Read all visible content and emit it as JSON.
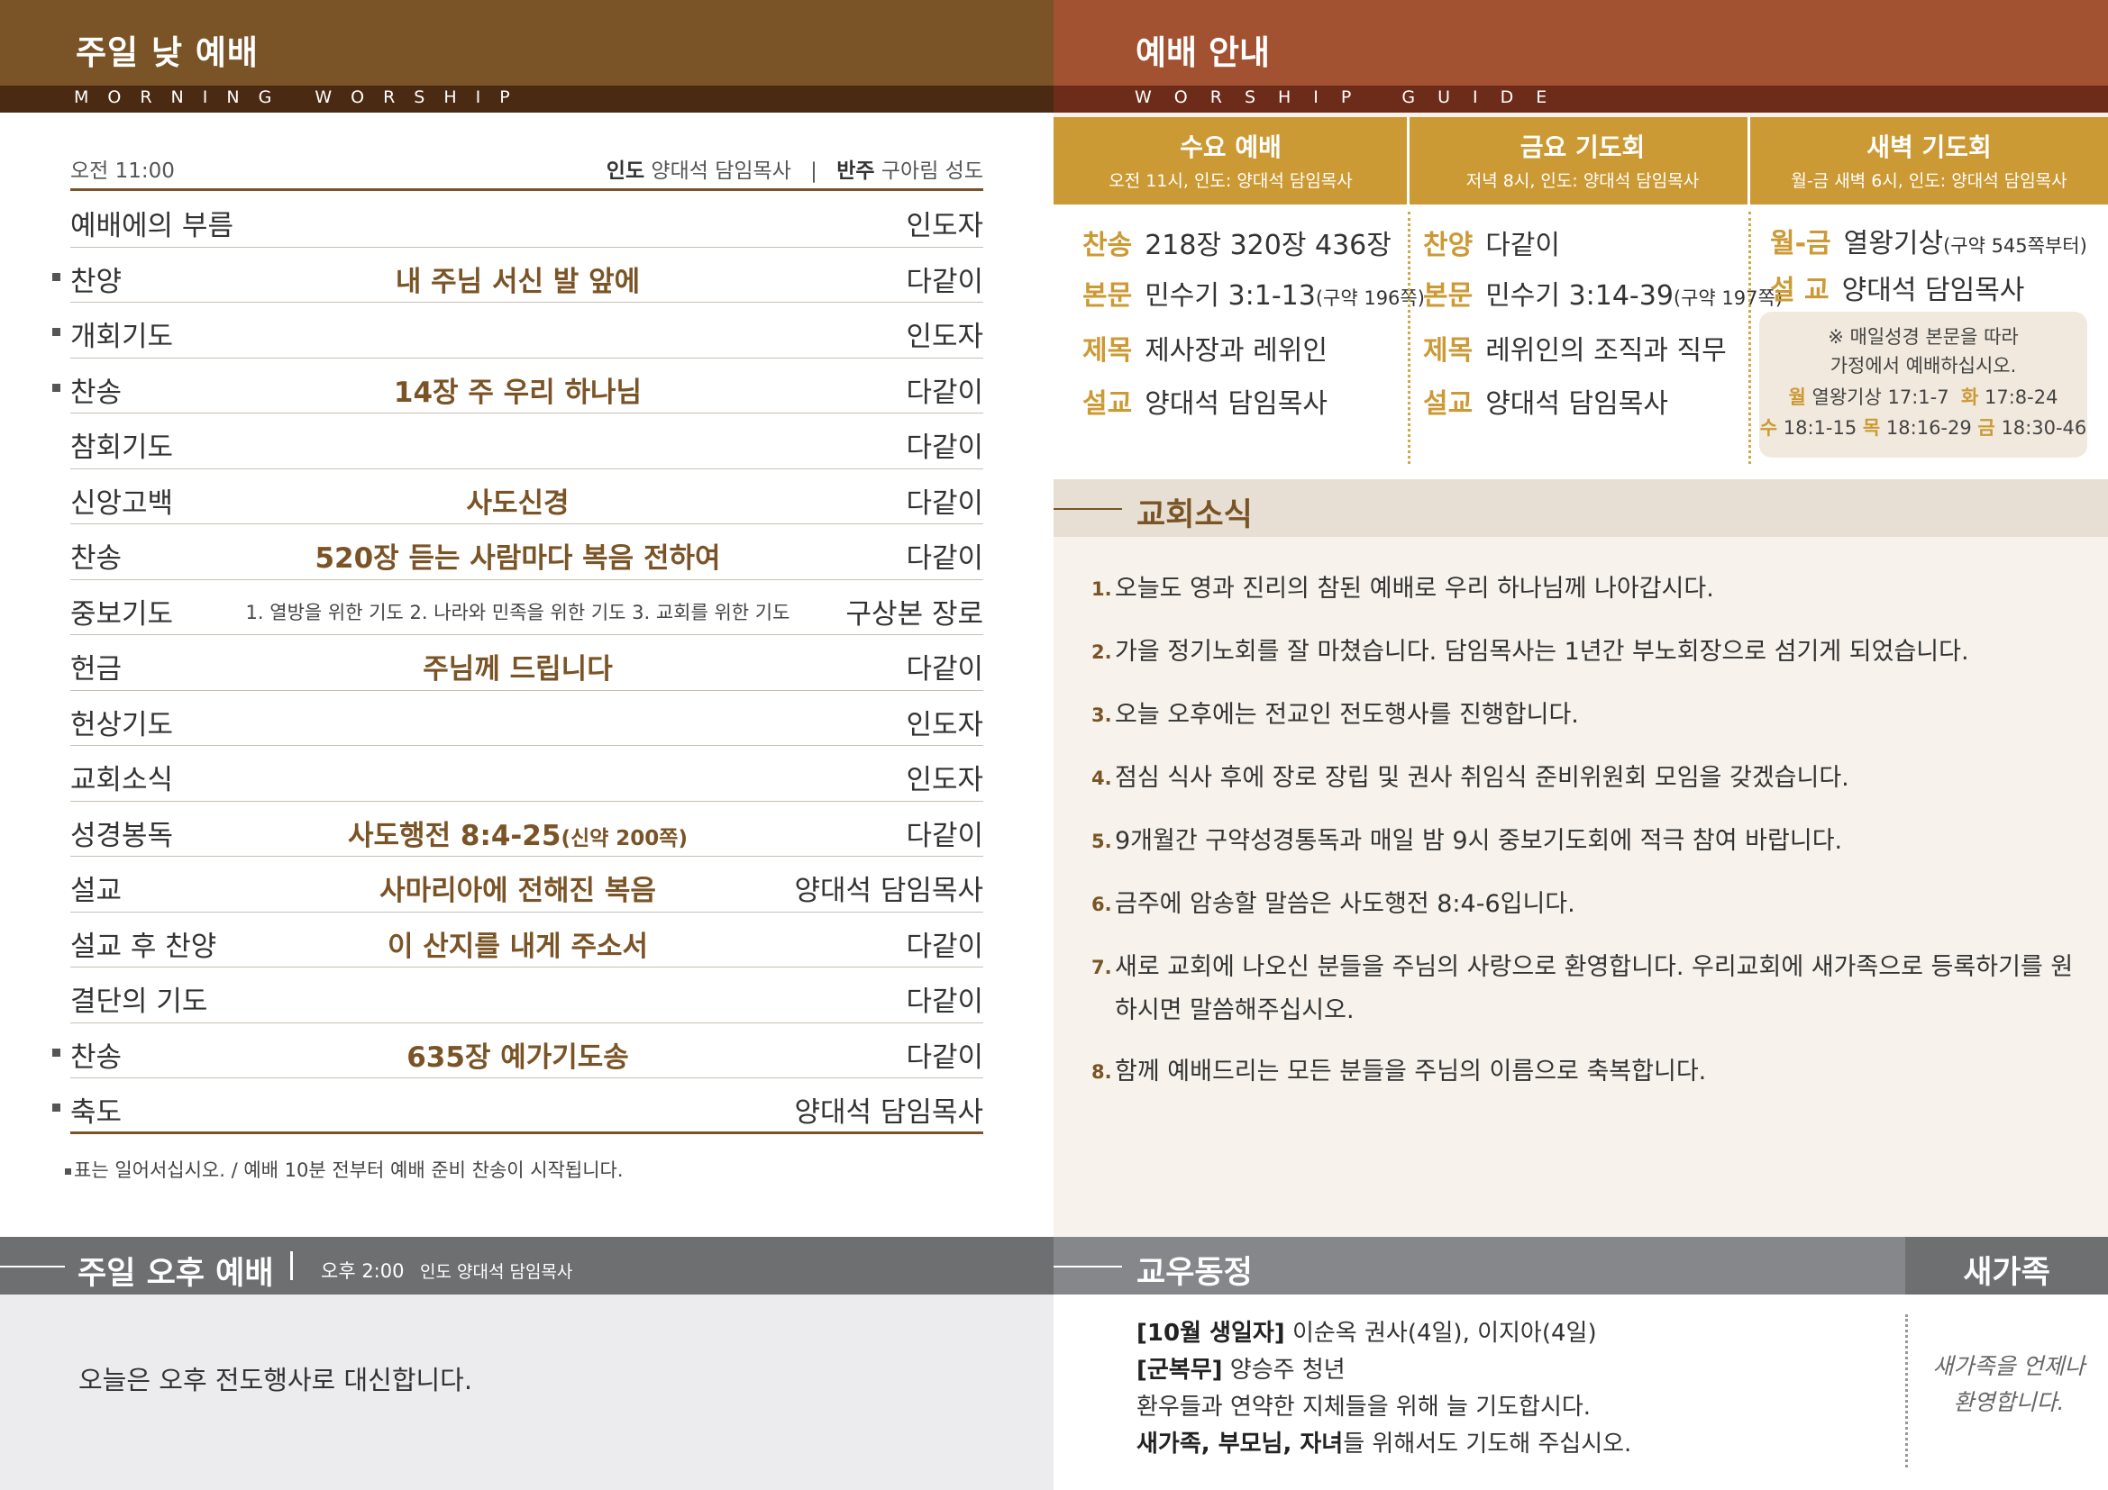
{
  "morning": {
    "title": "주일 낮 예배",
    "subtitle": "MORNING   WORSHIP",
    "time": "오전 11:00",
    "leader_label": "인도",
    "leader": "양대석 담임목사",
    "accomp_label": "반주",
    "accomp": "구아림 성도",
    "separator": "|",
    "rows": [
      {
        "item": "예배에의 부름",
        "center": "",
        "leader": "인도자",
        "stand": false
      },
      {
        "item": "찬양",
        "center": "내 주님 서신 발 앞에",
        "leader": "다같이",
        "stand": true
      },
      {
        "item": "개회기도",
        "center": "",
        "leader": "인도자",
        "stand": true
      },
      {
        "item": "찬송",
        "center": "14장 주 우리 하나님",
        "leader": "다같이",
        "stand": true
      },
      {
        "item": "참회기도",
        "center": "",
        "leader": "다같이",
        "stand": false
      },
      {
        "item": "신앙고백",
        "center": "사도신경",
        "leader": "다같이",
        "stand": false
      },
      {
        "item": "찬송",
        "center": "520장 듣는 사람마다 복음 전하여",
        "leader": "다같이",
        "stand": false
      },
      {
        "item": "중보기도",
        "center": "1. 열방을 위한 기도  2. 나라와 민족을 위한 기도  3. 교회를 위한 기도",
        "leader": "구상본 장로",
        "stand": false,
        "small": true
      },
      {
        "item": "헌금",
        "center": "주님께 드립니다",
        "leader": "다같이",
        "stand": false
      },
      {
        "item": "헌상기도",
        "center": "",
        "leader": "인도자",
        "stand": false
      },
      {
        "item": "교회소식",
        "center": "",
        "leader": "인도자",
        "stand": false
      },
      {
        "item": "성경봉독",
        "center": "사도행전 8:4-25",
        "center_sub": "(신약 200쪽)",
        "leader": "다같이",
        "stand": false
      },
      {
        "item": "설교",
        "center": "사마리아에 전해진 복음",
        "leader": "양대석 담임목사",
        "stand": false
      },
      {
        "item": "설교 후 찬양",
        "center": "이 산지를 내게 주소서",
        "leader": "다같이",
        "stand": false
      },
      {
        "item": "결단의 기도",
        "center": "",
        "leader": "다같이",
        "stand": false
      },
      {
        "item": "찬송",
        "center": "635장 예가기도송",
        "leader": "다같이",
        "stand": true
      },
      {
        "item": "축도",
        "center": "",
        "leader": "양대석 담임목사",
        "stand": true
      }
    ],
    "note": "표는 일어서십시오. / 예배 10분 전부터 예배 준비 찬송이 시작됩니다."
  },
  "afternoon": {
    "title": "주일 오후 예배",
    "time": "오후 2:00",
    "leader": "인도 양대석 담임목사",
    "text": "오늘은 오후 전도행사로 대신합니다."
  },
  "guide": {
    "title": "예배 안내",
    "subtitle": "WORSHIP   GUIDE",
    "wednesday": {
      "name": "수요 예배",
      "info": "오전 11시, 인도: 양대석 담임목사",
      "lines": [
        {
          "label": "찬송",
          "text": "218장 320장 436장",
          "small": ""
        },
        {
          "label": "본문",
          "text": "민수기 3:1-13",
          "small": "(구약 196쪽)"
        },
        {
          "label": "제목",
          "text": "제사장과 레위인",
          "small": ""
        },
        {
          "label": "설교",
          "text": "양대석 담임목사",
          "small": ""
        }
      ]
    },
    "friday": {
      "name": "금요 기도회",
      "info": "저녁 8시, 인도: 양대석 담임목사",
      "lines": [
        {
          "label": "찬양",
          "text": "다같이",
          "small": ""
        },
        {
          "label": "본문",
          "text": "민수기 3:14-39",
          "small": "(구약 197쪽)"
        },
        {
          "label": "제목",
          "text": "레위인의 조직과 직무",
          "small": ""
        },
        {
          "label": "설교",
          "text": "양대석 담임목사",
          "small": ""
        }
      ]
    },
    "dawn": {
      "name": "새벽 기도회",
      "info": "월-금 새벽 6시, 인도: 양대석 담임목사",
      "lines": [
        {
          "label": "월-금",
          "text": "열왕기상",
          "small": "(구약 545쪽부터)"
        },
        {
          "label": "설 교",
          "text": "양대석 담임목사",
          "small": ""
        }
      ],
      "daily": {
        "line1": "※ 매일성경 본문을 따라",
        "line2": "가정에서 예배하십시오.",
        "mon_label": "월",
        "mon": "열왕기상 17:1-7",
        "tue_label": "화",
        "tue": "17:8-24",
        "wed_label": "수",
        "wed": "18:1-15",
        "thu_label": "목",
        "thu": "18:16-29",
        "fri_label": "금",
        "fri": "18:30-46"
      }
    }
  },
  "news": {
    "title": "교회소식",
    "items": [
      {
        "num": "1.",
        "text": "오늘도 영과 진리의 참된 예배로 우리 하나님께 나아갑시다."
      },
      {
        "num": "2.",
        "text": "가을 정기노회를 잘 마쳤습니다. 담임목사는 1년간 부노회장으로 섬기게 되었습니다."
      },
      {
        "num": "3.",
        "text": "오늘 오후에는 전교인 전도행사를 진행합니다."
      },
      {
        "num": "4.",
        "text": "점심 식사 후에 장로 장립 및 권사 취임식 준비위원회 모임을 갖겠습니다."
      },
      {
        "num": "5.",
        "text": "9개월간 구약성경통독과 매일 밤 9시 중보기도회에 적극 참여 바랍니다."
      },
      {
        "num": "6.",
        "text": "금주에 암송할 말씀은 사도행전 8:4-6입니다."
      },
      {
        "num": "7.",
        "text": "새로 교회에 나오신 분들을 주님의 사랑으로 환영합니다. 우리교회에 새가족으로 등록하기를 원하시면 말씀해주십시오."
      },
      {
        "num": "8.",
        "text": "함께 예배드리는 모든 분들을 주님의 이름으로 축복합니다."
      }
    ]
  },
  "friends": {
    "title": "교우동정",
    "birthday_label": "[10월 생일자]",
    "birthday": " 이순옥 권사(4일), 이지아(4일)",
    "military_label": "[군복무]",
    "military": " 양승주 청년",
    "prayer": "환우들과 연약한 지체들을 위해 늘 기도합시다.",
    "family_bold": "새가족, 부모님, 자녀",
    "family_rest": "들 위해서도 기도해 주십시오."
  },
  "newfamily": {
    "title": "새가족",
    "line1": "새가족을 언제나",
    "line2": "환영합니다."
  },
  "colors": {
    "brown": "#7a5426",
    "brown_dark": "#4a2a12",
    "rust": "#a35231",
    "gold": "#cc9a34",
    "gray": "#6e6f71"
  }
}
